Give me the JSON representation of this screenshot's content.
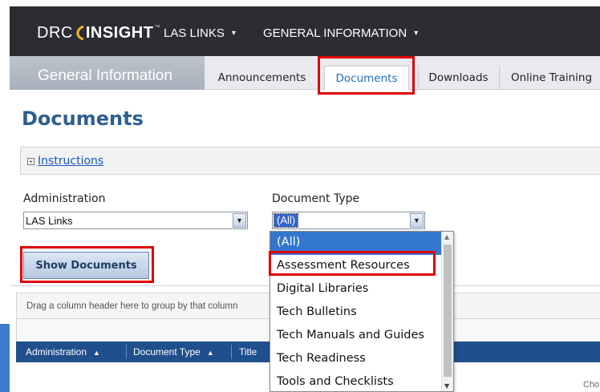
{
  "header": {
    "logo": {
      "text_left": "DRC",
      "text_right": "INSIGHT",
      "trademark": "™"
    },
    "nav": [
      {
        "label": "LAS LINKS",
        "caret": "▾"
      },
      {
        "label": "GENERAL INFORMATION",
        "caret": "▾"
      }
    ]
  },
  "subnav": {
    "section_title": "General Information",
    "tabs": [
      {
        "label": "Announcements"
      },
      {
        "label": "Documents",
        "active": true
      },
      {
        "label": "Downloads"
      },
      {
        "label": "Online Training"
      }
    ]
  },
  "page": {
    "title": "Documents"
  },
  "instructions": {
    "toggle": "⊞",
    "label": "Instructions"
  },
  "filters": {
    "administration": {
      "label": "Administration",
      "value": "LAS Links"
    },
    "document_type": {
      "label": "Document Type",
      "value": "(All)"
    }
  },
  "show_button": {
    "label": "Show Documents"
  },
  "grid": {
    "group_hint": "Drag a column header here to group by that column",
    "columns": [
      {
        "label": "Administration",
        "sort": "▲"
      },
      {
        "label": "Document Type",
        "sort": "▲"
      },
      {
        "label": "Title"
      }
    ]
  },
  "dropdown": {
    "options": [
      "(All)",
      "Assessment Resources",
      "Digital Libraries",
      "Tech Bulletins",
      "Tech Manuals and Guides",
      "Tech Readiness",
      "Tools and Checklists"
    ],
    "selected_index": 0
  },
  "corner_text": "Cho",
  "colors": {
    "topbar_bg": "#2c2d33",
    "accent_blue": "#2e5f8e",
    "grid_header": "#1f4f8c",
    "highlight_red": "#e00000",
    "selection_blue": "#3377cc"
  },
  "icons": {
    "select_arrow": "⌄",
    "scroll_up": "▲",
    "scroll_down": "▼"
  }
}
